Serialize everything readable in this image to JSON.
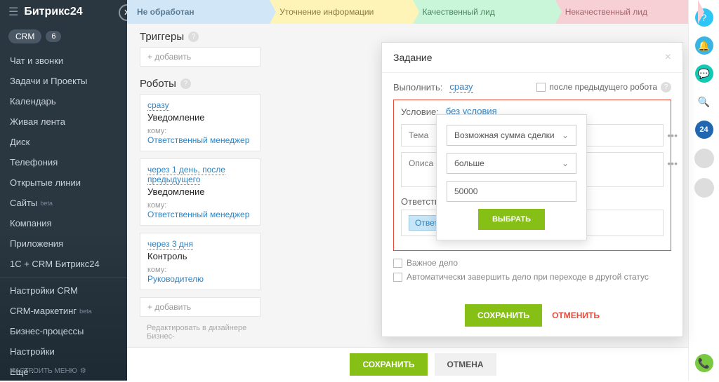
{
  "sidebar": {
    "logo": "Битрикс24",
    "crm_label": "CRM",
    "crm_count": "6",
    "items": [
      {
        "label": "Чат и звонки"
      },
      {
        "label": "Задачи и Проекты"
      },
      {
        "label": "Календарь"
      },
      {
        "label": "Живая лента"
      },
      {
        "label": "Диск"
      },
      {
        "label": "Телефония"
      },
      {
        "label": "Открытые линии"
      },
      {
        "label": "Сайты",
        "beta": "beta"
      },
      {
        "label": "Компания"
      },
      {
        "label": "Приложения"
      },
      {
        "label": "1С + CRM Битрикс24"
      },
      {
        "label": "Настройки CRM"
      },
      {
        "label": "CRM-маркетинг",
        "beta": "beta"
      },
      {
        "label": "Бизнес-процессы"
      },
      {
        "label": "Настройки"
      },
      {
        "label": "Ещё ·"
      }
    ],
    "footer": "НАСТРОИТЬ МЕНЮ"
  },
  "stages": {
    "s1": "Не обработан",
    "s2": "Уточнение информации",
    "s3": "Качественный лид",
    "s4": "Некачественный лид"
  },
  "sections": {
    "triggers": "Триггеры",
    "robots": "Роботы",
    "add": "+ добавить",
    "designer_note": "Редактировать в дизайнере Бизнес-"
  },
  "robots": [
    {
      "timing": "сразу",
      "title": "Уведомление",
      "to_label": "кому:",
      "to": "Ответственный менеджер"
    },
    {
      "timing": "через 1 день, после предыдущего",
      "title": "Уведомление",
      "to_label": "кому:",
      "to": "Ответственный менеджер"
    },
    {
      "timing": "через 3 дня",
      "title": "Контроль",
      "to_label": "кому:",
      "to": "Руководителю"
    }
  ],
  "modal": {
    "title": "Задание",
    "execute_label": "Выполнить:",
    "execute_link": "сразу",
    "after_prev": "после предыдущего робота",
    "condition_label": "Условие:",
    "condition_link": "без условия",
    "subject_ph": "Тема",
    "descr_ph": "Описа",
    "responsible": "Ответстве",
    "resp_tag": "Ответс",
    "important": "Важное дело",
    "autoclose": "Автоматически завершить дело при переходе в другой статус",
    "save": "СОХРАНИТЬ",
    "cancel": "ОТМЕНИТЬ"
  },
  "dropdown": {
    "field": "Возможная сумма сделки",
    "op": "больше",
    "value": "50000",
    "select": "ВЫБРАТЬ"
  },
  "footer": {
    "save": "СОХРАНИТЬ",
    "cancel": "ОТМЕНА"
  },
  "shadow": {
    "add": "авить",
    "designer": "ровать в дизайнере Бизнес-"
  }
}
